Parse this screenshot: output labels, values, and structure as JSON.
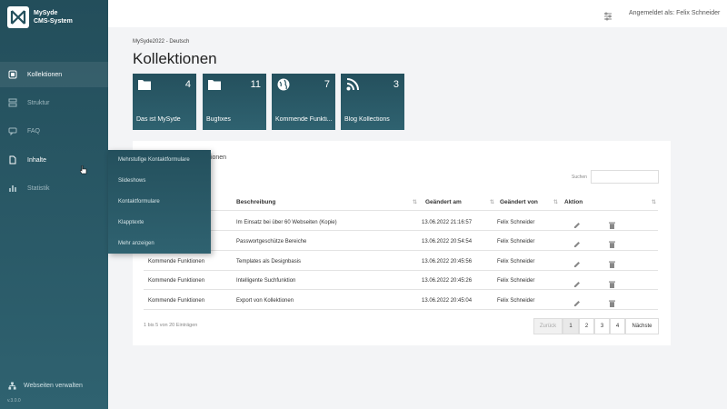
{
  "app": {
    "name": "MySyde",
    "subtitle": "CMS-System",
    "version": "v.3.0.0"
  },
  "sidebar": {
    "items": [
      {
        "label": "Kollektionen",
        "icon": "layers-icon"
      },
      {
        "label": "Struktur",
        "icon": "structure-icon"
      },
      {
        "label": "FAQ",
        "icon": "chat-icon"
      },
      {
        "label": "Inhalte",
        "icon": "document-icon"
      },
      {
        "label": "Statistik",
        "icon": "chart-icon"
      }
    ],
    "footer": {
      "label": "Webseiten verwalten",
      "icon": "sitemap-icon"
    }
  },
  "header": {
    "user_label": "Angemeldet als: Felix Schneider",
    "settings_icon": "sliders-icon"
  },
  "breadcrumb": "MySyde2022 - Deutsch",
  "page_title": "Kollektionen",
  "cards": [
    {
      "label": "Das ist MySyde",
      "count": "4",
      "icon": "folder-icon"
    },
    {
      "label": "Bugfixes",
      "count": "11",
      "icon": "folder-icon"
    },
    {
      "label": "Kommende Funkti...",
      "count": "7",
      "icon": "globe-icon"
    },
    {
      "label": "Blog Kollections",
      "count": "3",
      "icon": "rss-icon"
    }
  ],
  "panel": {
    "title_fragment": "tionen",
    "search": {
      "label": "Suchen",
      "value": ""
    },
    "columns": [
      "Beschreibung",
      "Geändert am",
      "Geändert von",
      "Aktion"
    ],
    "rows": [
      {
        "kollektion": "",
        "beschreibung": "Im Einsatz bei über 60 Webseiten (Kopie)",
        "geaendert_am": "13.06.2022 21:16:57",
        "geaendert_von": "Felix Schneider"
      },
      {
        "kollektion": "",
        "beschreibung": "Passwortgeschütze Bereiche",
        "geaendert_am": "13.06.2022 20:54:54",
        "geaendert_von": "Felix Schneider"
      },
      {
        "kollektion": "Kommende Funktionen",
        "beschreibung": "Templates als Designbasis",
        "geaendert_am": "13.06.2022 20:45:56",
        "geaendert_von": "Felix Schneider"
      },
      {
        "kollektion": "Kommende Funktionen",
        "beschreibung": "Intelligente Suchfunktion",
        "geaendert_am": "13.06.2022 20:45:26",
        "geaendert_von": "Felix Schneider"
      },
      {
        "kollektion": "Kommende Funktionen",
        "beschreibung": "Export von Kollektionen",
        "geaendert_am": "13.06.2022 20:45:04",
        "geaendert_von": "Felix Schneider"
      }
    ],
    "info": "1 bis 5 von 20 Einträgen",
    "pagination": {
      "prev": "Zurück",
      "pages": [
        "1",
        "2",
        "3",
        "4"
      ],
      "next": "Nächste"
    }
  },
  "dropdown": {
    "items": [
      "Mehrstufige Kontaktformulare",
      "Slideshows",
      "Kontaktformulare",
      "Klapptexte",
      "Mehr anzeigen"
    ]
  },
  "colors": {
    "sidebar": "#2a5a67",
    "accent": "#24505d",
    "background": "#f3f4f6"
  }
}
